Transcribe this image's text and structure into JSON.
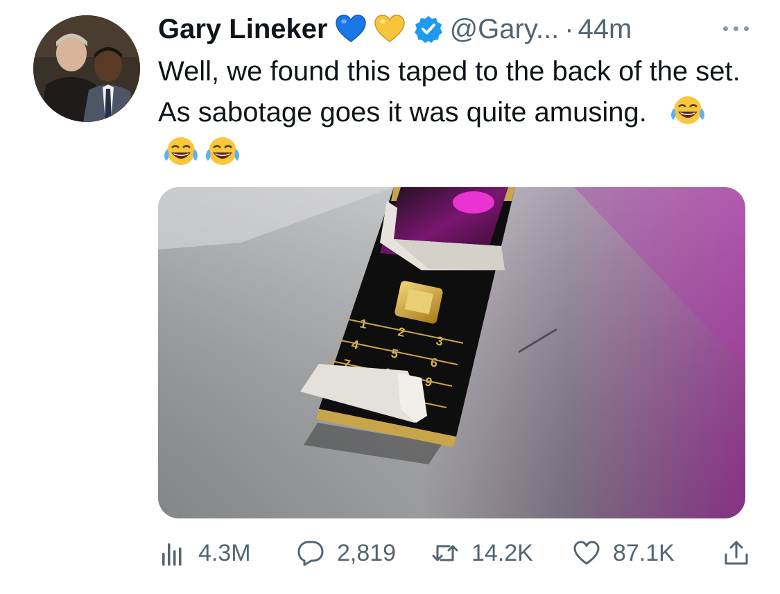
{
  "author": {
    "name": "Gary Lineker",
    "handle": "@Gary...",
    "separator": "·",
    "time": "44m",
    "badges": [
      "blue-heart-icon",
      "yellow-heart-icon",
      "verified-badge-icon"
    ]
  },
  "tweet": {
    "text": "Well, we found this taped to the back of the set. As sabotage goes it was quite amusing.",
    "emojis": [
      "laughing-tears-icon",
      "laughing-tears-icon",
      "laughing-tears-icon"
    ]
  },
  "actions": {
    "views": "4.3M",
    "replies": "2,819",
    "retweets": "14.2K",
    "likes": "87.1K"
  },
  "colors": {
    "verified": "#1d9bf0",
    "secondary_text": "#536471",
    "primary_text": "#0f1419"
  }
}
